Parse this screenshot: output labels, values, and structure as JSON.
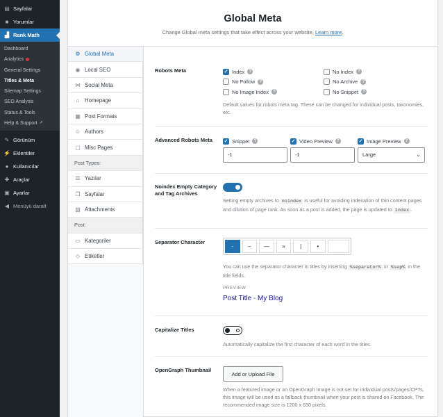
{
  "sidebar": {
    "top_items": [
      {
        "label": "Sayfalar",
        "icon": "pages-icon"
      },
      {
        "label": "Yorumlar",
        "icon": "comments-icon"
      }
    ],
    "active": {
      "label": "Rank Math",
      "icon": "rank-math-icon"
    },
    "sub_items": [
      "Dashboard",
      "Analytics",
      "General Settings",
      "Titles & Meta",
      "Sitemap Settings",
      "SEO Analysis",
      "Status & Tools",
      "Help & Support"
    ],
    "bottom_items": [
      {
        "label": "Görünüm",
        "icon": "appearance-icon"
      },
      {
        "label": "Eklentiler",
        "icon": "plugins-icon"
      },
      {
        "label": "Kullanıcılar",
        "icon": "users-icon"
      },
      {
        "label": "Araçlar",
        "icon": "tools-icon"
      },
      {
        "label": "Ayarlar",
        "icon": "settings-icon"
      }
    ],
    "collapse": "Menüyü daralt"
  },
  "header": {
    "title": "Global Meta",
    "subtitle": "Change Global meta settings that take effect across your website.",
    "link": "Learn more",
    "period": "."
  },
  "nav": {
    "items": [
      {
        "label": "Global Meta",
        "icon": "gear-icon"
      },
      {
        "label": "Local SEO",
        "icon": "location-pin-icon"
      },
      {
        "label": "Social Meta",
        "icon": "share-icon"
      },
      {
        "label": "Homepage",
        "icon": "home-icon"
      },
      {
        "label": "Post Formats",
        "icon": "post-formats-icon"
      },
      {
        "label": "Authors",
        "icon": "authors-icon"
      },
      {
        "label": "Misc Pages",
        "icon": "misc-pages-icon"
      }
    ],
    "post_types_heading": "Post Types:",
    "post_types": [
      {
        "label": "Yazılar",
        "icon": "posts-icon"
      },
      {
        "label": "Sayfalar",
        "icon": "page-icon"
      },
      {
        "label": "Attachments",
        "icon": "attachment-icon"
      }
    ],
    "post_heading": "Post:",
    "post": [
      {
        "label": "Kategoriler",
        "icon": "folder-icon"
      },
      {
        "label": "Etiketler",
        "icon": "tag-icon"
      }
    ]
  },
  "robots_meta": {
    "label": "Robots Meta",
    "left": [
      {
        "label": "Index",
        "checked": true
      },
      {
        "label": "No Follow",
        "checked": false
      },
      {
        "label": "No Image Index",
        "checked": false
      }
    ],
    "right": [
      {
        "label": "No Index",
        "checked": false
      },
      {
        "label": "No Archive",
        "checked": false
      },
      {
        "label": "No Snippet",
        "checked": false
      }
    ],
    "desc": "Default values for robots meta tag. These can be changed for individual posts, taxonomies, etc."
  },
  "advanced_robots": {
    "label": "Advanced Robots Meta",
    "snippet": {
      "label": "Snippet",
      "value": "-1"
    },
    "video": {
      "label": "Video Preview",
      "value": "-1"
    },
    "image": {
      "label": "Image Preview",
      "value": "Large"
    }
  },
  "noindex_empty": {
    "label": "Noindex Empty Category and Tag Archives",
    "enabled": true,
    "desc_a": "Setting empty archives to",
    "code_a": "noindex",
    "desc_b": "is useful for avoiding indexation of thin content pages and dilution of page rank. As soon as a post is added, the page is updated to",
    "code_b": "index",
    "desc_c": "."
  },
  "separator": {
    "label": "Separator Character",
    "options": [
      "-",
      "–",
      "—",
      "»",
      "|",
      "•"
    ],
    "selected_index": 0,
    "desc_a": "You can use the separator character in titles by inserting",
    "code_a": "%separator%",
    "desc_or": "or",
    "code_b": "%sep%",
    "desc_b": "in the title fields.",
    "preview_label": "PREVIEW",
    "preview_title": "Post Title",
    "preview_sep": "-",
    "preview_site": "My Blog"
  },
  "capitalize": {
    "label": "Capitalize Titles",
    "enabled": false,
    "desc": "Automatically capitalize the first character of each word in the titles."
  },
  "og_thumbnail": {
    "label": "OpenGraph Thumbnail",
    "button": "Add or Upload File",
    "desc": "When a featured image or an OpenGraph Image is not set for individual posts/pages/CPTs, this image will be used as a fallback thumbnail when your post is shared on Facebook. The recommended image size is 1200 x 630 pixels."
  },
  "colors": {
    "accent": "#2271b1",
    "sidebar_bg": "#1d2327",
    "submenu_bg": "#2c3338"
  }
}
